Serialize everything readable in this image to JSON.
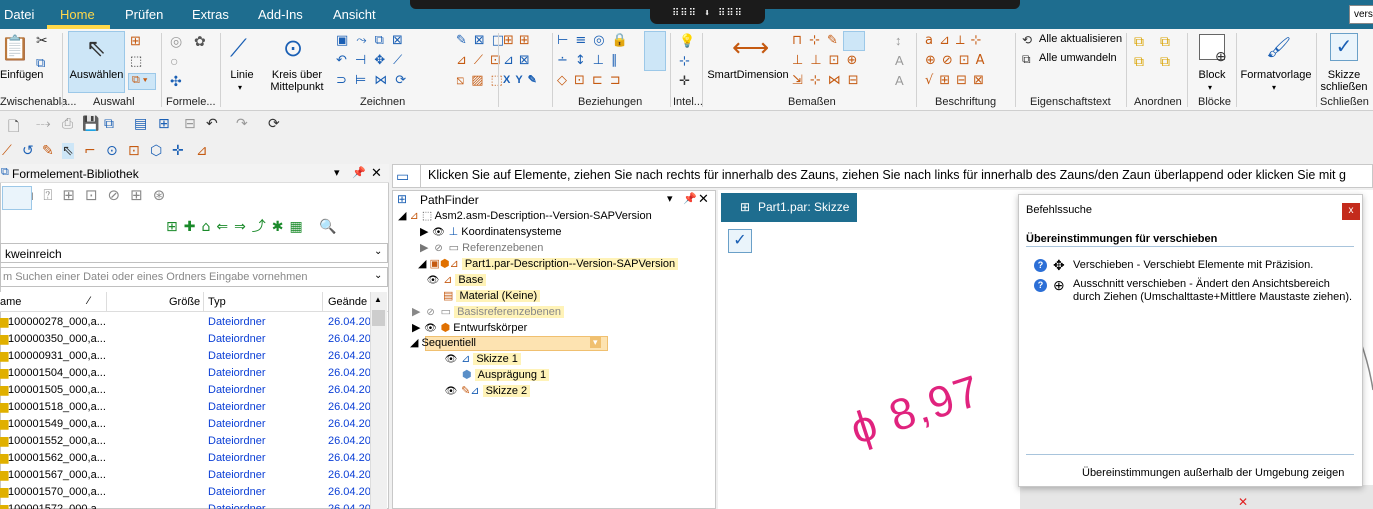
{
  "menu": {
    "items": [
      "Datei",
      "Home",
      "Prüfen",
      "Extras",
      "Add-Ins",
      "Ansicht"
    ],
    "active": "Home",
    "command_pill": "⠿⠿⠿ ⬇ ⠿⠿⠿",
    "search_value": "versc"
  },
  "ribbon": {
    "groups": {
      "zwischenablage": "Zwischenabla...",
      "auswahl": "Auswahl",
      "formelement": "Formele...",
      "zeichnen": "Zeichnen",
      "beziehungen": "Beziehungen",
      "intel": "Intel...",
      "bemassen": "Bemaßen",
      "beschriftung": "Beschriftung",
      "eigenschaftstext": "Eigenschaftstext",
      "anordnen": "Anordnen",
      "bloecke": "Blöcke",
      "schliessen": "Schließen"
    },
    "buttons": {
      "einfuegen": "Einfügen",
      "auswaehlen": "Auswählen",
      "linie": "Linie",
      "kreis": "Kreis über\nMittelpunkt",
      "smartdimension": "SmartDimension",
      "alle_aktualisieren": "Alle aktualisieren",
      "alle_umwandeln": "Alle umwandeln",
      "block": "Block",
      "formatvorlage": "Formatvorlage",
      "skizze_schliessen": "Skizze\nschließen"
    }
  },
  "prompt": "Klicken Sie auf Elemente, ziehen Sie nach rechts für innerhalb des Zauns, ziehen Sie nach links für innerhalb des Zauns/den Zaun überlappend oder klicken Sie mit g",
  "library": {
    "title": "Formelement-Bibliothek",
    "folder": "kweinreich",
    "search_placeholder": "m Suchen einer Datei oder eines Ordners Eingabe vornehmen",
    "columns": {
      "name": "ame",
      "size": "Größe",
      "type": "Typ",
      "changed": "Geände"
    },
    "rows": [
      {
        "name": "100000278_000,a...",
        "type": "Dateiordner",
        "date": "26.04.20"
      },
      {
        "name": "100000350_000,a...",
        "type": "Dateiordner",
        "date": "26.04.20"
      },
      {
        "name": "100000931_000,a...",
        "type": "Dateiordner",
        "date": "26.04.20"
      },
      {
        "name": "100001504_000,a...",
        "type": "Dateiordner",
        "date": "26.04.20"
      },
      {
        "name": "100001505_000,a...",
        "type": "Dateiordner",
        "date": "26.04.20"
      },
      {
        "name": "100001518_000,a...",
        "type": "Dateiordner",
        "date": "26.04.20"
      },
      {
        "name": "100001549_000,a...",
        "type": "Dateiordner",
        "date": "26.04.20"
      },
      {
        "name": "100001552_000,a...",
        "type": "Dateiordner",
        "date": "26.04.20"
      },
      {
        "name": "100001562_000,a...",
        "type": "Dateiordner",
        "date": "26.04.20"
      },
      {
        "name": "100001567_000,a...",
        "type": "Dateiordner",
        "date": "26.04.20"
      },
      {
        "name": "100001570_000,a...",
        "type": "Dateiordner",
        "date": "26.04.20"
      },
      {
        "name": "100001572_000,a...",
        "type": "Dateiordner",
        "date": "26.04.20"
      }
    ]
  },
  "pathfinder": {
    "title": "PathFinder",
    "assembly": "Asm2.asm-Description--Version-SAPVersion",
    "items": {
      "koordinatensysteme": "Koordinatensysteme",
      "referenzebenen": "Referenzebenen",
      "part": "Part1.par-Description--Version-SAPVersion",
      "base": "Base",
      "material": "Material (Keine)",
      "basisreferenzebenen": "Basisreferenzebenen",
      "entwurfskoerper": "Entwurfskörper",
      "sequentiell": "Sequentiell",
      "skizze1": "Skizze 1",
      "auspraegung1": "Ausprägung 1",
      "skizze2": "Skizze 2"
    }
  },
  "document": {
    "tab": "Part1.par: Skizze",
    "dimension": "ϕ 8,97"
  },
  "befehlssuche": {
    "title": "Befehlssuche",
    "heading": "Übereinstimmungen für  verschieben",
    "result1": "Verschieben - Verschiebt Elemente mit Präzision.",
    "result2": "Ausschnitt verschieben - Ändert den Ansichtsbereich durch Ziehen (Umschalttaste+Mittlere Maustaste ziehen).",
    "footer": "Übereinstimmungen außerhalb der Umgebung zeigen",
    "close": "x"
  },
  "colors": {
    "topbar": "#1e6d8f",
    "active_tab": "#ffd84a",
    "highlight": "#fff3b8",
    "dimension": "#e0237e",
    "link_blue": "#0b3fd6"
  }
}
